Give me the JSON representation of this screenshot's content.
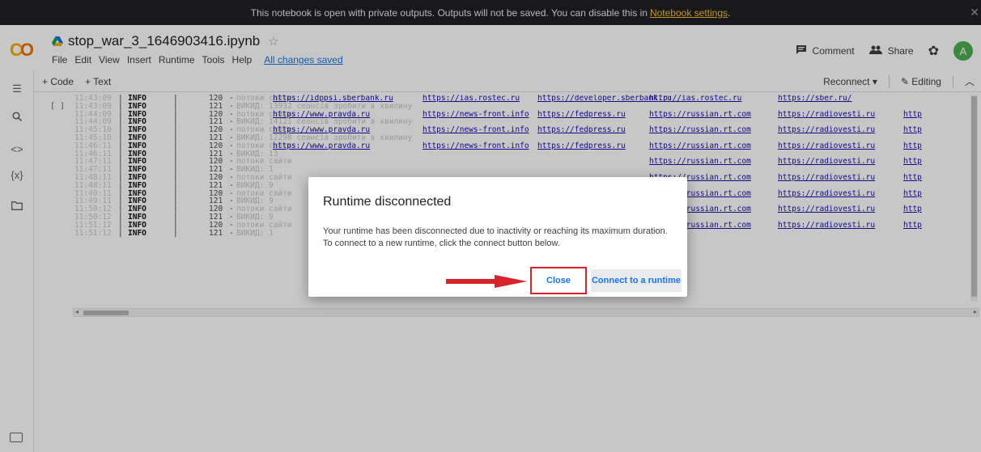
{
  "banner": {
    "text": "This notebook is open with private outputs. Outputs will not be saved. You can disable this in",
    "link": "Notebook settings",
    "suffix": "."
  },
  "header": {
    "logo": "CO",
    "title": "stop_war_3_1646903416.ipynb",
    "menu": [
      "File",
      "Edit",
      "View",
      "Insert",
      "Runtime",
      "Tools",
      "Help"
    ],
    "saved_status": "All changes saved",
    "comment_label": "Comment",
    "share_label": "Share",
    "avatar_letter": "A"
  },
  "toolbar": {
    "add_code": "+ Code",
    "add_text": "+ Text",
    "reconnect": "Reconnect",
    "editing": "Editing"
  },
  "cell": {
    "run_indicator": "[ ]",
    "log_rows": [
      {
        "time": "11:43:09",
        "level": "INFO",
        "code": "120",
        "msg": "потоки сайти:",
        "links": [
          "https://idppsi.sberbank.ru",
          "https://ias.rostec.ru",
          "https://developer.sberbank.ru",
          "http://ias.rostec.ru",
          "https://sber.ru/"
        ]
      },
      {
        "time": "11:43:09",
        "level": "INFO",
        "code": "121",
        "msg": "ВИКИД: 13932 сеансів зробити в хвилину",
        "links": []
      },
      {
        "time": "11:44:09",
        "level": "INFO",
        "code": "120",
        "msg": "потоки сайти:",
        "links": [
          "https://www.pravda.ru",
          "https://news-front.info",
          "https://fedpress.ru",
          "https://russian.rt.com",
          "https://radiovesti.ru",
          "http"
        ]
      },
      {
        "time": "11:44:09",
        "level": "INFO",
        "code": "121",
        "msg": "ВИКИД: 14121 сеансів зробити в хвилину",
        "links": []
      },
      {
        "time": "11:45:10",
        "level": "INFO",
        "code": "120",
        "msg": "потоки сайти:",
        "links": [
          "https://www.pravda.ru",
          "https://news-front.info",
          "https://fedpress.ru",
          "https://russian.rt.com",
          "https://radiovesti.ru",
          "http"
        ]
      },
      {
        "time": "11:45:10",
        "level": "INFO",
        "code": "121",
        "msg": "ВИКИД: 12298 сеансів зробити в хвилину",
        "links": []
      },
      {
        "time": "11:46:11",
        "level": "INFO",
        "code": "120",
        "msg": "потоки сайти:",
        "links": [
          "https://www.pravda.ru",
          "https://news-front.info",
          "https://fedpress.ru",
          "https://russian.rt.com",
          "https://radiovesti.ru",
          "http"
        ]
      },
      {
        "time": "11:46:11",
        "level": "INFO",
        "code": "121",
        "msg": "ВИКИД: 13",
        "links": []
      },
      {
        "time": "11:47:11",
        "level": "INFO",
        "code": "120",
        "msg": "потоки сайти",
        "links": [
          "",
          "",
          "",
          "https://russian.rt.com",
          "https://radiovesti.ru",
          "http"
        ]
      },
      {
        "time": "11:47:11",
        "level": "INFO",
        "code": "121",
        "msg": "ВИКИД: 1",
        "links": []
      },
      {
        "time": "11:48:11",
        "level": "INFO",
        "code": "120",
        "msg": "потоки сайти",
        "links": [
          "",
          "",
          "",
          "https://russian.rt.com",
          "https://radiovesti.ru",
          "http"
        ]
      },
      {
        "time": "11:48:11",
        "level": "INFO",
        "code": "121",
        "msg": "ВИКИД: 9",
        "links": []
      },
      {
        "time": "11:49:11",
        "level": "INFO",
        "code": "120",
        "msg": "потоки сайти",
        "links": [
          "",
          "",
          "",
          "https://russian.rt.com",
          "https://radiovesti.ru",
          "http"
        ]
      },
      {
        "time": "11:49:11",
        "level": "INFO",
        "code": "121",
        "msg": "ВИКИД: 9",
        "links": []
      },
      {
        "time": "11:50:12",
        "level": "INFO",
        "code": "120",
        "msg": "потоки сайти",
        "links": [
          "",
          "",
          "",
          "https://russian.rt.com",
          "https://radiovesti.ru",
          "http"
        ]
      },
      {
        "time": "11:50:12",
        "level": "INFO",
        "code": "121",
        "msg": "ВИКИД: 9",
        "links": []
      },
      {
        "time": "11:51:12",
        "level": "INFO",
        "code": "120",
        "msg": "потоки сайти",
        "links": [
          "",
          "",
          "",
          "https://russian.rt.com",
          "https://radiovesti.ru",
          "http"
        ]
      },
      {
        "time": "11:51:12",
        "level": "INFO",
        "code": "121",
        "msg": "ВИКИД: 1",
        "links": []
      }
    ]
  },
  "dialog": {
    "title": "Runtime disconnected",
    "body_line1": "Your runtime has been disconnected due to inactivity or reaching its maximum duration.",
    "body_line2": "To connect to a new runtime, click the connect button below.",
    "close_label": "Close",
    "connect_label": "Connect to a runtime",
    "arrow_color": "#d9232a"
  },
  "colors": {
    "accent": "#1a73e8",
    "highlight_border": "#d9232a",
    "banner_bg": "#202124",
    "banner_link": "#fbc02d"
  }
}
